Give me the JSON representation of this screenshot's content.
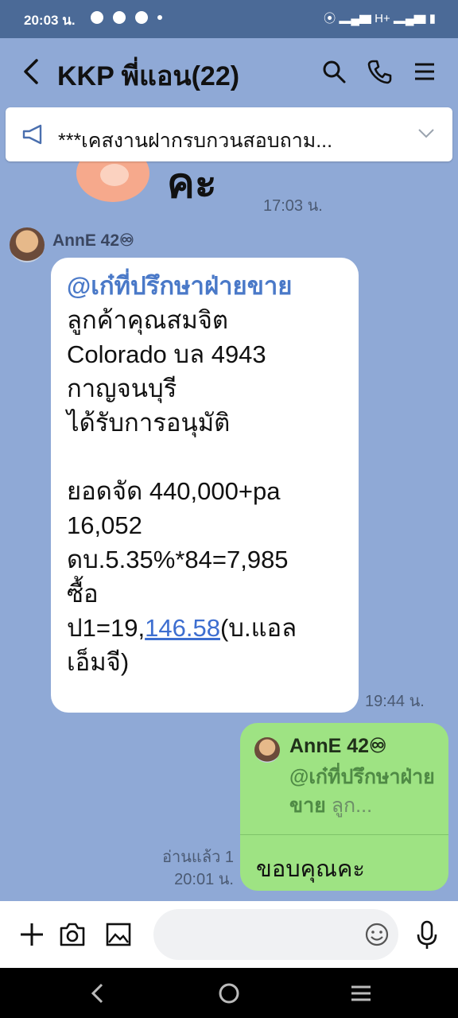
{
  "status_bar": {
    "time": "20:03 น.",
    "network": "H+"
  },
  "header": {
    "title": "KKP พี่แอน(22)"
  },
  "announcement": {
    "text": "***เคสงานฝากรบกวนสอบถาม..."
  },
  "messages": {
    "sticker_time": "17:03 น.",
    "incoming": {
      "sender": "AnnE 42♾",
      "mention": "@เก๋ที่ปรึกษาฝ่ายขาย",
      "line1_rest": " ลูกค้าคุณสมจิต",
      "line2": "Colorado บล 4943",
      "line3": "กาญจนบุรี",
      "line4": "ได้รับการอนุมัติ",
      "line5": "ยอดจัด 440,000+pa",
      "line6": "16,052",
      "line7": "ดบ.5.35%*84=7,985",
      "line8": "ซื้อ",
      "line9_prefix": "ป1=19,",
      "line9_link": "146.58",
      "line9_suffix": "(บ.แอล",
      "line10": "เอ็มจี)",
      "time": "19:44 น."
    },
    "outgoing": {
      "quote_sender": "AnnE 42♾",
      "quote_mention": "@เก๋ที่ปรึกษาฝ่ายขาย",
      "quote_rest": " ลูก...",
      "text": "ขอบคุณคะ",
      "read_status": "อ่านแล้ว 1",
      "time": "20:01 น."
    }
  },
  "colors": {
    "header_bg": "#8fa9d6",
    "status_bg": "#4b6a97",
    "outgoing_bubble": "#9ee383",
    "incoming_bubble": "#ffffff",
    "link": "#3d6ed0"
  }
}
